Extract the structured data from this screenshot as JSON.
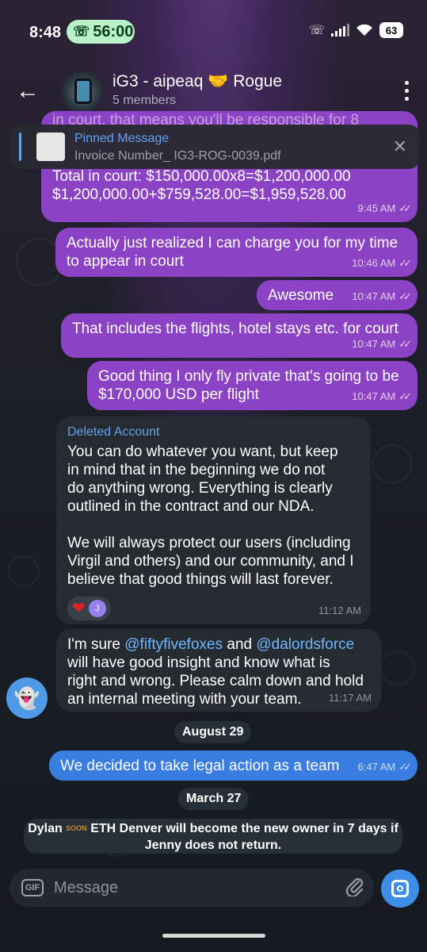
{
  "status_bar": {
    "time": "8:48",
    "call_timer": "56:00",
    "battery": "63"
  },
  "header": {
    "title": "iG3 - aipeaq 🤝 Rogue",
    "subtitle": "5 members"
  },
  "pinned": {
    "title": "Pinned Message",
    "file": "Invoice Number_ IG3-ROG-0039.pdf"
  },
  "messages": [
    {
      "lines": [
        "in court, that means you'll be responsible for 8",
        "Total in court: $150,000.00x8=$1,200,000.00",
        "$1,200,000.00+$759,528.00=$1,959,528.00"
      ],
      "time": "9:45 AM"
    },
    {
      "lines": [
        "Actually just realized I can charge you for my time",
        "to appear in court"
      ],
      "time": "10:46 AM"
    },
    {
      "text": "Awesome",
      "time": "10:47 AM"
    },
    {
      "text": "That includes the flights, hotel stays etc. for court",
      "time": "10:47 AM"
    },
    {
      "lines": [
        "Good thing I only fly private that's going to be",
        "$170,000 USD per flight"
      ],
      "time": "10:47 AM"
    },
    {
      "author": "Deleted Account",
      "para1": [
        "You can do whatever you want, but keep",
        "in mind that in the beginning we do not",
        "do anything wrong. Everything is clearly",
        "outlined in the contract and our NDA."
      ],
      "para2": [
        "We will always protect our users (including",
        "Virgil and others) and our community, and I",
        "believe that good things will last forever."
      ],
      "reaction_initial": "J",
      "time": "11:12 AM"
    },
    {
      "line1_pre": "I'm sure ",
      "mention1": "@fiftyfivefoxes",
      "line1_mid": " and ",
      "mention2": "@dalordsforce",
      "lines": [
        "will have good insight and know what is",
        "right and wrong. Please calm down and hold",
        "an internal meeting with your team."
      ],
      "time": "11:17 AM"
    },
    {
      "text": "We decided to take legal action as a team",
      "time": "6:47 AM"
    }
  ],
  "dates": [
    "August 29",
    "March 27"
  ],
  "service": {
    "from": "Dylan",
    "soon": "SOON",
    "rest": "ETH Denver will become the new owner in 7 days if",
    "line2": "Jenny does not return."
  },
  "composer": {
    "placeholder": "Message",
    "gif_label": "GIF"
  },
  "colors": {
    "outgoing": "#8c42c4",
    "outgoing_blue": "#3a7de0",
    "incoming": "#262b31",
    "accent": "#63a3f2"
  }
}
